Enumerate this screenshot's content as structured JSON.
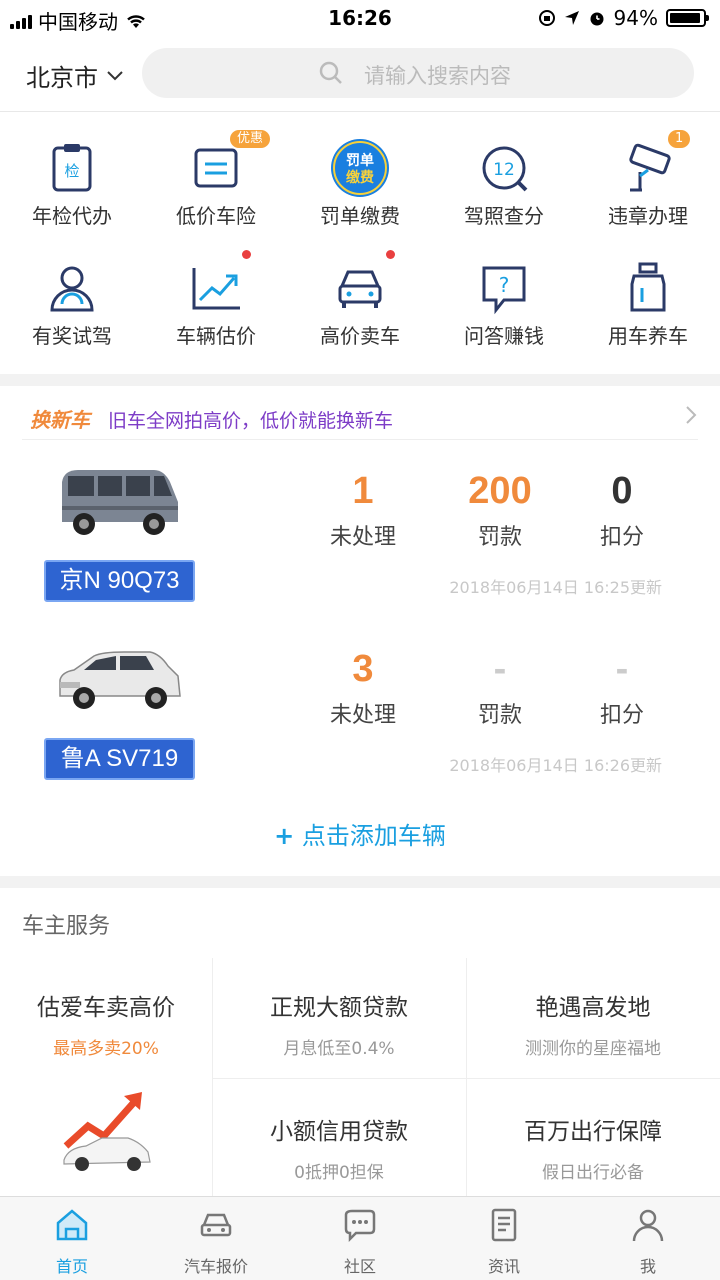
{
  "status_bar": {
    "carrier": "中国移动",
    "time": "16:26",
    "battery": "94%",
    "battery_level": 0.94
  },
  "header": {
    "city": "北京市",
    "search_placeholder": "请输入搜索内容"
  },
  "quick_services": [
    {
      "label": "年检代办",
      "icon": "inspection-icon",
      "icon_text": "检"
    },
    {
      "label": "低价车险",
      "icon": "insurance-icon",
      "badge": "优惠"
    },
    {
      "label": "罚单缴费",
      "icon": "fine-payment-icon",
      "icon_text": "罚单缴费"
    },
    {
      "label": "驾照查分",
      "icon": "license-points-icon",
      "icon_text": "12"
    },
    {
      "label": "违章办理",
      "icon": "camera-icon",
      "badge": "1"
    },
    {
      "label": "有奖试驾",
      "icon": "test-drive-icon"
    },
    {
      "label": "车辆估价",
      "icon": "valuation-chart-icon",
      "dot": true
    },
    {
      "label": "高价卖车",
      "icon": "sell-car-icon",
      "dot": true
    },
    {
      "label": "问答赚钱",
      "icon": "qa-icon",
      "icon_text": "?"
    },
    {
      "label": "用车养车",
      "icon": "oil-can-icon"
    }
  ],
  "promo": {
    "tag": "换新车",
    "text": "旧车全网拍高价，低价就能换新车"
  },
  "vehicles": [
    {
      "plate": "京N 90Q73",
      "car": "van-image",
      "stats": [
        {
          "value": "1",
          "label": "未处理"
        },
        {
          "value": "200",
          "label": "罚款"
        },
        {
          "value": "0",
          "label": "扣分"
        }
      ],
      "updated": "2018年06月14日 16:25更新"
    },
    {
      "plate": "鲁A SV719",
      "car": "suv-image",
      "stats": [
        {
          "value": "3",
          "label": "未处理"
        },
        {
          "value": "-",
          "label": "罚款"
        },
        {
          "value": "-",
          "label": "扣分"
        }
      ],
      "updated": "2018年06月14日 16:26更新"
    }
  ],
  "add_vehicle": "点击添加车辆",
  "owner_services": {
    "title": "车主服务",
    "feature": {
      "title": "估爱车卖高价",
      "subtitle": "最高多卖20%"
    },
    "items": [
      {
        "title": "正规大额贷款",
        "subtitle": "月息低至0.4%"
      },
      {
        "title": "艳遇高发地",
        "subtitle": "测测你的星座福地"
      },
      {
        "title": "小额信用贷款",
        "subtitle": "0抵押0担保"
      },
      {
        "title": "百万出行保障",
        "subtitle": "假日出行必备"
      }
    ]
  },
  "tab_bar": [
    {
      "label": "首页",
      "icon": "home-icon",
      "active": true
    },
    {
      "label": "汽车报价",
      "icon": "car-price-icon"
    },
    {
      "label": "社区",
      "icon": "community-icon"
    },
    {
      "label": "资讯",
      "icon": "news-icon"
    },
    {
      "label": "我",
      "icon": "profile-icon"
    }
  ],
  "colors": {
    "accent_blue": "#1a9fe0",
    "orange": "#f08a3c",
    "plate_blue": "#2e64d1",
    "icon_navy": "#2b3a67"
  }
}
